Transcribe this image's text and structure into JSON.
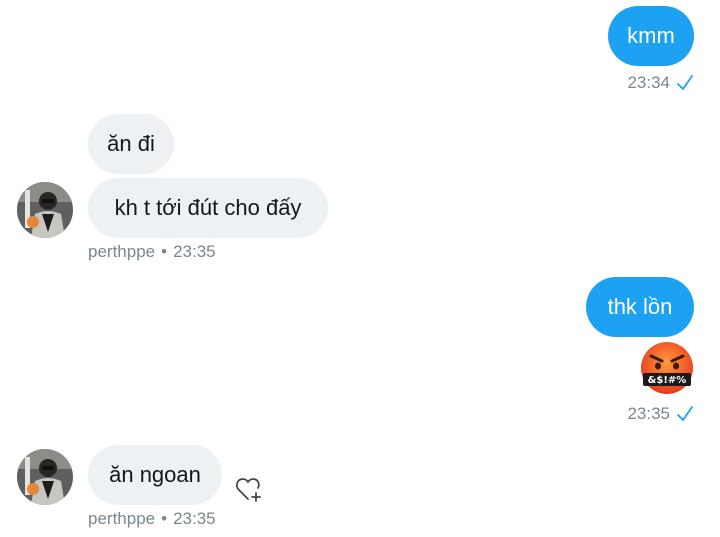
{
  "conversation": {
    "messages": [
      {
        "direction": "sent",
        "text": "kmm"
      },
      {
        "direction": "received",
        "text": "ăn đi"
      },
      {
        "direction": "received",
        "text": "kh t tới đút cho đấy"
      },
      {
        "direction": "sent",
        "text": "thk lồn"
      },
      {
        "direction": "sent",
        "emoji": "pouting-face-with-symbols-emoji"
      },
      {
        "direction": "received",
        "text": "ăn ngoan"
      }
    ],
    "meta": [
      {
        "time": "23:34",
        "status": "read-check-icon"
      },
      {
        "sender": "perthppe",
        "separator": "•",
        "time": "23:35"
      },
      {
        "time": "23:35",
        "status": "read-check-icon"
      },
      {
        "sender": "perthppe",
        "separator": "•",
        "time": "23:35"
      }
    ],
    "emoji_caption": "&$!#%"
  },
  "colors": {
    "sent_bubble": "#1da1f2",
    "received_bubble": "#eef1f3",
    "meta_text": "#7a8790",
    "check": "#1da1f2"
  },
  "icons": {
    "react": "heart-plus-icon",
    "check": "read-check-icon"
  }
}
